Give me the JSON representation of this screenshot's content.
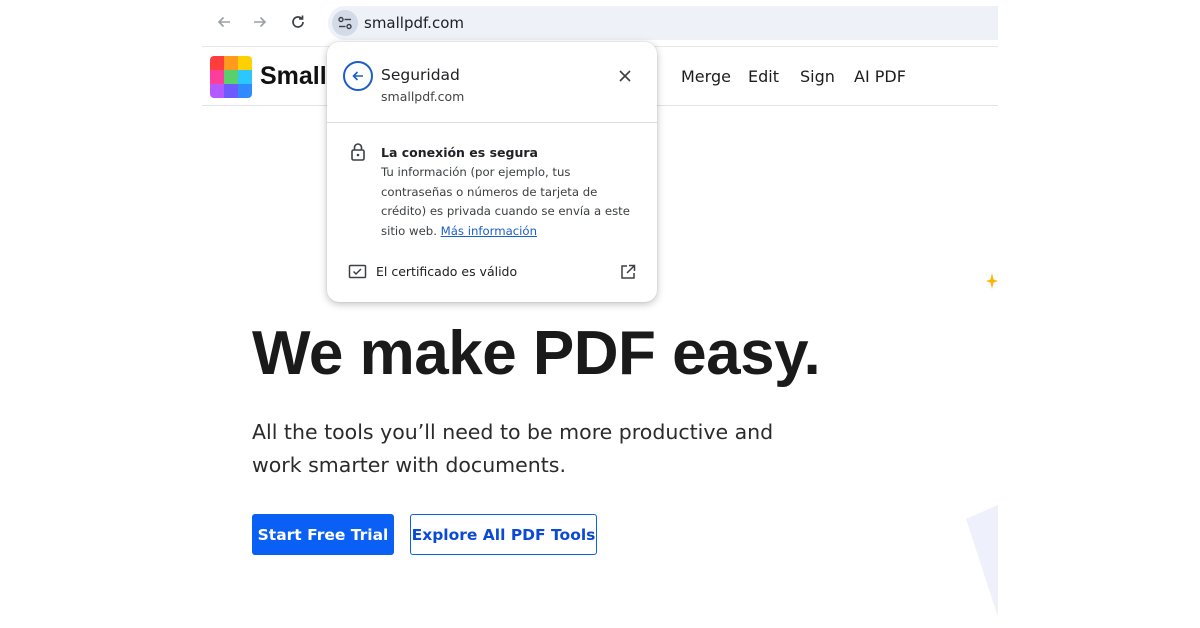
{
  "browser": {
    "url": "smallpdf.com",
    "icons": {
      "back": "arrow-left-icon",
      "forward": "arrow-right-icon",
      "reload": "reload-icon",
      "site_info": "tune-icon"
    }
  },
  "site": {
    "brand": "Smallpdf",
    "brand_visible": "Small",
    "nav": [
      "Merge",
      "Edit",
      "Sign",
      "AI PDF"
    ],
    "logo_colors": [
      "#ff3d3d",
      "#ff9a1f",
      "#ffd000",
      "#ff3d9a",
      "#5ad06c",
      "#2dc7ff",
      "#b259ff",
      "#6c5cff",
      "#2f8bff"
    ]
  },
  "hero": {
    "title": "We make PDF easy.",
    "subtitle": "All the tools you’ll need to be more productive and work smarter with documents.",
    "primary_button": "Start Free Trial",
    "secondary_button": "Explore All PDF Tools"
  },
  "popup": {
    "title": "Seguridad",
    "domain": "smallpdf.com",
    "connection_title": "La conexión es segura",
    "connection_desc": "Tu información (por ejemplo, tus contraseñas o números de tarjeta de crédito) es privada cuando se envía a este sitio web.",
    "more_info_link": "Más información",
    "certificate": "El certificado es válido"
  },
  "colors": {
    "accent": "#0a5ff5",
    "popup_link": "#1a5ec8",
    "spark": "#ffb300"
  }
}
